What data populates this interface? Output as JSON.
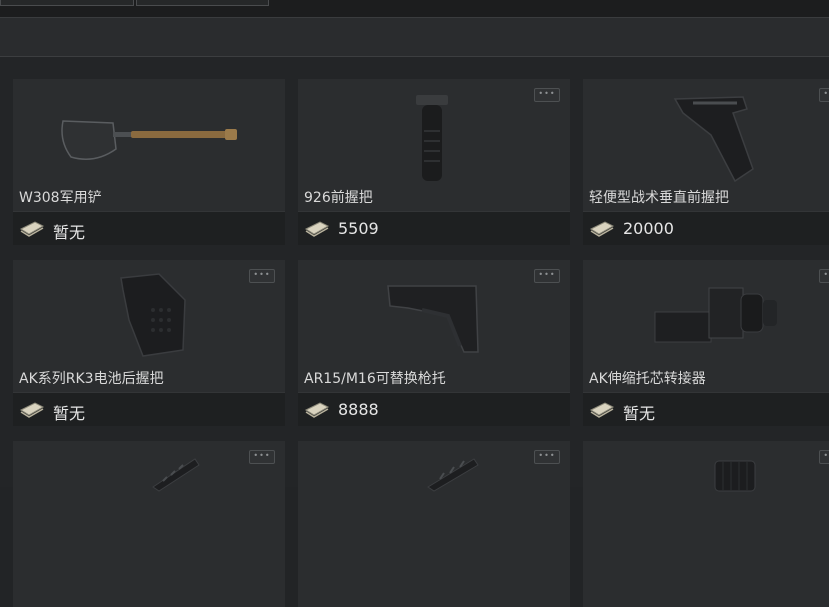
{
  "items": [
    {
      "name": "W308军用铲",
      "price": "暂无",
      "icon": "shovel-icon"
    },
    {
      "name": "926前握把",
      "price": "5509",
      "icon": "foregrip-icon"
    },
    {
      "name": "轻便型战术垂直前握把",
      "price": "20000",
      "icon": "tactical-foregrip-icon"
    },
    {
      "name": "AK系列RK3电池后握把",
      "price": "暂无",
      "icon": "pistol-grip-icon"
    },
    {
      "name": "AR15/M16可替换枪托",
      "price": "8888",
      "icon": "stock-icon"
    },
    {
      "name": "AK伸缩托芯转接器",
      "price": "暂无",
      "icon": "stock-adapter-icon"
    },
    {
      "name": "",
      "price": "",
      "icon": "rail-icon"
    },
    {
      "name": "",
      "price": "",
      "icon": "rail-mount-icon"
    },
    {
      "name": "",
      "price": "",
      "icon": "part-icon"
    }
  ],
  "more_label": "•••"
}
